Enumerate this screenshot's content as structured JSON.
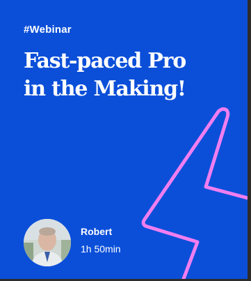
{
  "card": {
    "hashtag": "#Webinar",
    "title_lines": [
      "Fast-paced Pro",
      "in the Making!"
    ],
    "presenter": {
      "name": "Robert",
      "duration": "1h 50min"
    }
  },
  "colors": {
    "background": "#0b4fd9",
    "accent_bolt": "#f07ef0",
    "text": "#ffffff"
  },
  "icons": {
    "decoration": "lightning-bolt-icon"
  }
}
